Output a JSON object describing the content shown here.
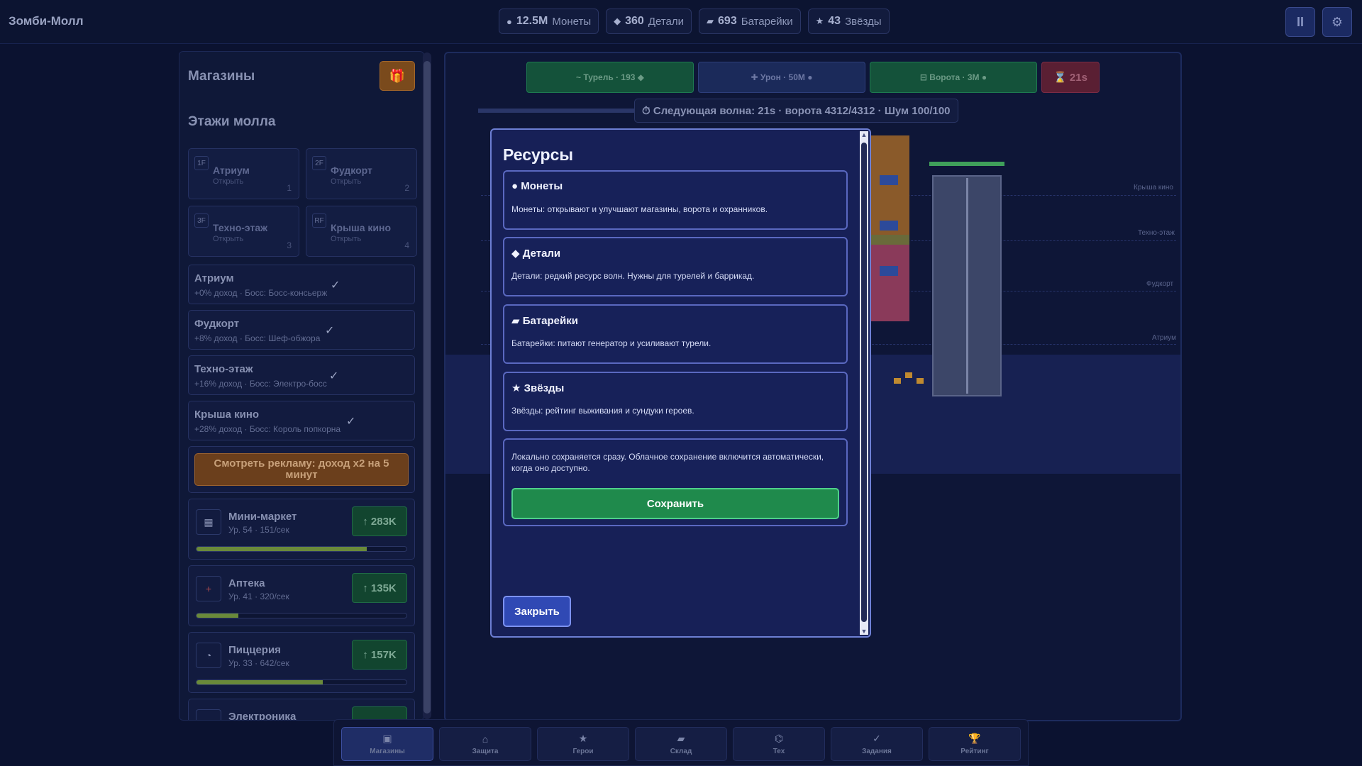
{
  "header": {
    "title": "Зомби-Молл",
    "resources": [
      {
        "icon": "●",
        "icon_name": "coin-icon",
        "value": "12.5M",
        "label": "Монеты"
      },
      {
        "icon": "◆",
        "icon_name": "parts-icon",
        "value": "360",
        "label": "Детали"
      },
      {
        "icon": "▰",
        "icon_name": "battery-icon",
        "value": "693",
        "label": "Батарейки"
      },
      {
        "icon": "★",
        "icon_name": "star-icon",
        "value": "43",
        "label": "Звёзды"
      }
    ],
    "pause_icon": "II",
    "settings_icon": "⚙"
  },
  "left_panel": {
    "title": "Магазины",
    "gift_icon": "🎁",
    "floors_title": "Этажи молла",
    "floors": [
      {
        "badge": "1F",
        "name": "Атриум",
        "status": "Открыть",
        "num": "1"
      },
      {
        "badge": "2F",
        "name": "Фудкорт",
        "status": "Открыть",
        "num": "2"
      },
      {
        "badge": "3F",
        "name": "Техно-этаж",
        "status": "Открыть",
        "num": "3"
      },
      {
        "badge": "RF",
        "name": "Крыша кино",
        "status": "Открыть",
        "num": "4"
      }
    ],
    "bosses": [
      {
        "name": "Атриум",
        "sub": "+0% доход · Босс: Босс-консьерж",
        "check": "✓"
      },
      {
        "name": "Фудкорт",
        "sub": "+8% доход · Босс: Шеф-обжора",
        "check": "✓"
      },
      {
        "name": "Техно-этаж",
        "sub": "+16% доход · Босс: Электро-босс",
        "check": "✓"
      },
      {
        "name": "Крыша кино",
        "sub": "+28% доход · Босс: Король попкорна",
        "check": "✓"
      }
    ],
    "ad_button": "Смотреть рекламу: доход x2 на 5 минут",
    "shops": [
      {
        "icon": "▦",
        "icon_name": "minimarket-icon",
        "name": "Мини-маркет",
        "sub": "Ур. 54 · 151/сек",
        "upgrade": "↑ 283K",
        "progress": 0.81
      },
      {
        "icon": "+",
        "icon_name": "pharmacy-icon",
        "name": "Аптека",
        "sub": "Ур. 41 · 320/сек",
        "upgrade": "↑ 135K",
        "progress": 0.2
      },
      {
        "icon": "◔",
        "icon_name": "pizzeria-icon",
        "name": "Пиццерия",
        "sub": "Ур. 33 · 642/сек",
        "upgrade": "↑ 157K",
        "progress": 0.6
      },
      {
        "icon": "▭",
        "icon_name": "electronics-icon",
        "name": "Электроника",
        "sub": "",
        "upgrade": "",
        "progress": 0
      }
    ]
  },
  "game": {
    "actions": [
      {
        "label": "~ Турель · 193 ◆",
        "style": "green"
      },
      {
        "label": "✚ Урон · 50M ●",
        "style": "dark"
      },
      {
        "label": "⊟ Ворота · 3M ●",
        "style": "green"
      },
      {
        "label": "⌛ 21s",
        "style": "red"
      }
    ],
    "wave_banner": "⏱ Следующая волна: 21s · ворота 4312/4312 · Шум 100/100",
    "floor_labels": [
      "Крыша кино",
      "Техно-этаж",
      "Фудкорт",
      "Атриум"
    ]
  },
  "modal": {
    "title": "Ресурсы",
    "cards": [
      {
        "title": "● Монеты",
        "desc": "Монеты: открывают и улучшают магазины, ворота и охранников."
      },
      {
        "title": "◆ Детали",
        "desc": "Детали: редкий ресурс волн. Нужны для турелей и баррикад."
      },
      {
        "title": "▰ Батарейки",
        "desc": "Батарейки: питают генератор и усиливают турели."
      },
      {
        "title": "★ Звёзды",
        "desc": "Звёзды: рейтинг выживания и сундуки героев."
      }
    ],
    "save_note": "Локально сохраняется сразу. Облачное сохранение включится автоматически, когда оно доступно.",
    "save_button": "Сохранить",
    "close_button": "Закрыть"
  },
  "bottom_nav": [
    {
      "icon": "▣",
      "icon_name": "shops-icon",
      "label": "Магазины",
      "active": true
    },
    {
      "icon": "⌂",
      "icon_name": "defense-icon",
      "label": "Защита",
      "active": false
    },
    {
      "icon": "★",
      "icon_name": "heroes-icon",
      "label": "Герои",
      "active": false
    },
    {
      "icon": "▰",
      "icon_name": "warehouse-icon",
      "label": "Склад",
      "active": false
    },
    {
      "icon": "⌬",
      "icon_name": "tech-icon",
      "label": "Тех",
      "active": false
    },
    {
      "icon": "✓",
      "icon_name": "tasks-icon",
      "label": "Задания",
      "active": false
    },
    {
      "icon": "🏆",
      "icon_name": "rating-icon",
      "label": "Рейтинг",
      "active": false
    }
  ]
}
